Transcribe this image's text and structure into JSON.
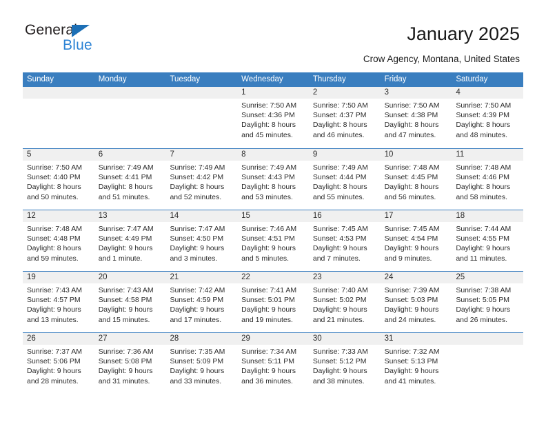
{
  "brand": {
    "name_part1": "General",
    "name_part2": "Blue",
    "triangle_color": "#1c6fb5",
    "blue_text_color": "#2b82d4"
  },
  "header": {
    "title": "January 2025",
    "subtitle": "Crow Agency, Montana, United States"
  },
  "theme": {
    "header_bar_color": "#3a7ebf",
    "daynum_bar_color": "#f0f0f0",
    "text_color": "#2b2b2b"
  },
  "calendar": {
    "weekdays": [
      "Sunday",
      "Monday",
      "Tuesday",
      "Wednesday",
      "Thursday",
      "Friday",
      "Saturday"
    ],
    "weeks": [
      [
        {
          "day": "",
          "lines": []
        },
        {
          "day": "",
          "lines": []
        },
        {
          "day": "",
          "lines": []
        },
        {
          "day": "1",
          "lines": [
            "Sunrise: 7:50 AM",
            "Sunset: 4:36 PM",
            "Daylight: 8 hours",
            "and 45 minutes."
          ]
        },
        {
          "day": "2",
          "lines": [
            "Sunrise: 7:50 AM",
            "Sunset: 4:37 PM",
            "Daylight: 8 hours",
            "and 46 minutes."
          ]
        },
        {
          "day": "3",
          "lines": [
            "Sunrise: 7:50 AM",
            "Sunset: 4:38 PM",
            "Daylight: 8 hours",
            "and 47 minutes."
          ]
        },
        {
          "day": "4",
          "lines": [
            "Sunrise: 7:50 AM",
            "Sunset: 4:39 PM",
            "Daylight: 8 hours",
            "and 48 minutes."
          ]
        }
      ],
      [
        {
          "day": "5",
          "lines": [
            "Sunrise: 7:50 AM",
            "Sunset: 4:40 PM",
            "Daylight: 8 hours",
            "and 50 minutes."
          ]
        },
        {
          "day": "6",
          "lines": [
            "Sunrise: 7:49 AM",
            "Sunset: 4:41 PM",
            "Daylight: 8 hours",
            "and 51 minutes."
          ]
        },
        {
          "day": "7",
          "lines": [
            "Sunrise: 7:49 AM",
            "Sunset: 4:42 PM",
            "Daylight: 8 hours",
            "and 52 minutes."
          ]
        },
        {
          "day": "8",
          "lines": [
            "Sunrise: 7:49 AM",
            "Sunset: 4:43 PM",
            "Daylight: 8 hours",
            "and 53 minutes."
          ]
        },
        {
          "day": "9",
          "lines": [
            "Sunrise: 7:49 AM",
            "Sunset: 4:44 PM",
            "Daylight: 8 hours",
            "and 55 minutes."
          ]
        },
        {
          "day": "10",
          "lines": [
            "Sunrise: 7:48 AM",
            "Sunset: 4:45 PM",
            "Daylight: 8 hours",
            "and 56 minutes."
          ]
        },
        {
          "day": "11",
          "lines": [
            "Sunrise: 7:48 AM",
            "Sunset: 4:46 PM",
            "Daylight: 8 hours",
            "and 58 minutes."
          ]
        }
      ],
      [
        {
          "day": "12",
          "lines": [
            "Sunrise: 7:48 AM",
            "Sunset: 4:48 PM",
            "Daylight: 8 hours",
            "and 59 minutes."
          ]
        },
        {
          "day": "13",
          "lines": [
            "Sunrise: 7:47 AM",
            "Sunset: 4:49 PM",
            "Daylight: 9 hours",
            "and 1 minute."
          ]
        },
        {
          "day": "14",
          "lines": [
            "Sunrise: 7:47 AM",
            "Sunset: 4:50 PM",
            "Daylight: 9 hours",
            "and 3 minutes."
          ]
        },
        {
          "day": "15",
          "lines": [
            "Sunrise: 7:46 AM",
            "Sunset: 4:51 PM",
            "Daylight: 9 hours",
            "and 5 minutes."
          ]
        },
        {
          "day": "16",
          "lines": [
            "Sunrise: 7:45 AM",
            "Sunset: 4:53 PM",
            "Daylight: 9 hours",
            "and 7 minutes."
          ]
        },
        {
          "day": "17",
          "lines": [
            "Sunrise: 7:45 AM",
            "Sunset: 4:54 PM",
            "Daylight: 9 hours",
            "and 9 minutes."
          ]
        },
        {
          "day": "18",
          "lines": [
            "Sunrise: 7:44 AM",
            "Sunset: 4:55 PM",
            "Daylight: 9 hours",
            "and 11 minutes."
          ]
        }
      ],
      [
        {
          "day": "19",
          "lines": [
            "Sunrise: 7:43 AM",
            "Sunset: 4:57 PM",
            "Daylight: 9 hours",
            "and 13 minutes."
          ]
        },
        {
          "day": "20",
          "lines": [
            "Sunrise: 7:43 AM",
            "Sunset: 4:58 PM",
            "Daylight: 9 hours",
            "and 15 minutes."
          ]
        },
        {
          "day": "21",
          "lines": [
            "Sunrise: 7:42 AM",
            "Sunset: 4:59 PM",
            "Daylight: 9 hours",
            "and 17 minutes."
          ]
        },
        {
          "day": "22",
          "lines": [
            "Sunrise: 7:41 AM",
            "Sunset: 5:01 PM",
            "Daylight: 9 hours",
            "and 19 minutes."
          ]
        },
        {
          "day": "23",
          "lines": [
            "Sunrise: 7:40 AM",
            "Sunset: 5:02 PM",
            "Daylight: 9 hours",
            "and 21 minutes."
          ]
        },
        {
          "day": "24",
          "lines": [
            "Sunrise: 7:39 AM",
            "Sunset: 5:03 PM",
            "Daylight: 9 hours",
            "and 24 minutes."
          ]
        },
        {
          "day": "25",
          "lines": [
            "Sunrise: 7:38 AM",
            "Sunset: 5:05 PM",
            "Daylight: 9 hours",
            "and 26 minutes."
          ]
        }
      ],
      [
        {
          "day": "26",
          "lines": [
            "Sunrise: 7:37 AM",
            "Sunset: 5:06 PM",
            "Daylight: 9 hours",
            "and 28 minutes."
          ]
        },
        {
          "day": "27",
          "lines": [
            "Sunrise: 7:36 AM",
            "Sunset: 5:08 PM",
            "Daylight: 9 hours",
            "and 31 minutes."
          ]
        },
        {
          "day": "28",
          "lines": [
            "Sunrise: 7:35 AM",
            "Sunset: 5:09 PM",
            "Daylight: 9 hours",
            "and 33 minutes."
          ]
        },
        {
          "day": "29",
          "lines": [
            "Sunrise: 7:34 AM",
            "Sunset: 5:11 PM",
            "Daylight: 9 hours",
            "and 36 minutes."
          ]
        },
        {
          "day": "30",
          "lines": [
            "Sunrise: 7:33 AM",
            "Sunset: 5:12 PM",
            "Daylight: 9 hours",
            "and 38 minutes."
          ]
        },
        {
          "day": "31",
          "lines": [
            "Sunrise: 7:32 AM",
            "Sunset: 5:13 PM",
            "Daylight: 9 hours",
            "and 41 minutes."
          ]
        },
        {
          "day": "",
          "lines": []
        }
      ]
    ]
  }
}
